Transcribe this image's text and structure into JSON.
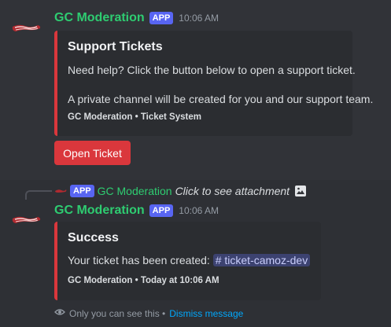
{
  "messages": [
    {
      "username": "GC Moderation",
      "badge": "APP",
      "timestamp": "10:06 AM",
      "embed": {
        "title": "Support Tickets",
        "line1": "Need help? Click the button below to open a support ticket.",
        "line2": "A private channel will be created for you and our support team.",
        "footer": "GC Moderation • Ticket System",
        "color": "#da373c"
      },
      "button": "Open Ticket"
    },
    {
      "reply": {
        "badge": "APP",
        "username": "GC Moderation",
        "text": "Click to see attachment"
      },
      "username": "GC Moderation",
      "badge": "APP",
      "timestamp": "10:06 AM",
      "embed": {
        "title": "Success",
        "text_prefix": "Your ticket has been created:",
        "channel": "# ticket-camoz-dev",
        "footer": "GC Moderation • Today at 10:06 AM",
        "color": "#da373c"
      },
      "ephemeral_note": "Only you can see this •",
      "dismiss": "Dismiss message"
    }
  ],
  "icons": {
    "avatar": "grizzly-logo-avatar",
    "attachment": "image-icon",
    "ephemeral": "eye-icon"
  },
  "colors": {
    "background": "#313338",
    "username": "#2ecc71",
    "app_badge": "#5865f2",
    "embed_bar": "#da373c",
    "button": "#da373c",
    "link": "#00a8fc"
  }
}
